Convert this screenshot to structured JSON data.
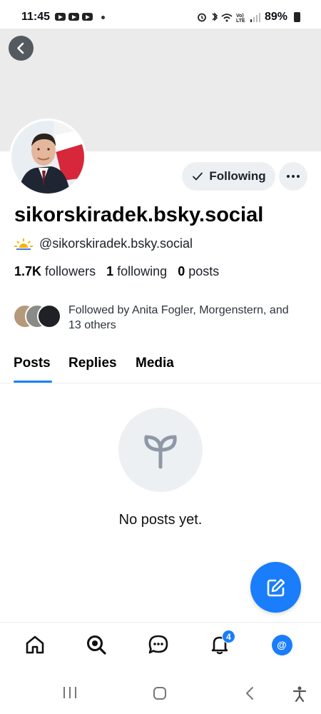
{
  "status_bar": {
    "time": "11:45",
    "battery": "89%",
    "icons": [
      "youtube-icon",
      "youtube-icon",
      "youtube-icon",
      "alarm-icon",
      "bluetooth-icon",
      "wifi-icon",
      "volte-icon",
      "signal-icon",
      "battery-icon"
    ]
  },
  "profile": {
    "display_name": "sikorskiradek.bsky.social",
    "handle": "@sikorskiradek.bsky.social",
    "follow_button": "Following",
    "followers_count": "1.7K",
    "followers_label": "followers",
    "following_count": "1",
    "following_label": "following",
    "posts_count": "0",
    "posts_label": "posts",
    "known_followers": "Followed by Anita Fogler, Morgenstern, and 13 others"
  },
  "tabs": [
    {
      "label": "Posts",
      "active": true
    },
    {
      "label": "Replies",
      "active": false
    },
    {
      "label": "Media",
      "active": false
    }
  ],
  "feed": {
    "empty_text": "No posts yet."
  },
  "bottom_nav": {
    "items": [
      "home-icon",
      "search-icon",
      "chat-icon",
      "notifications-icon",
      "profile-icon"
    ],
    "notification_count": "4",
    "profile_symbol": "@"
  },
  "colors": {
    "accent": "#1a7dfb",
    "banner": "#ebebeb",
    "button_bg": "#edf0f3"
  }
}
